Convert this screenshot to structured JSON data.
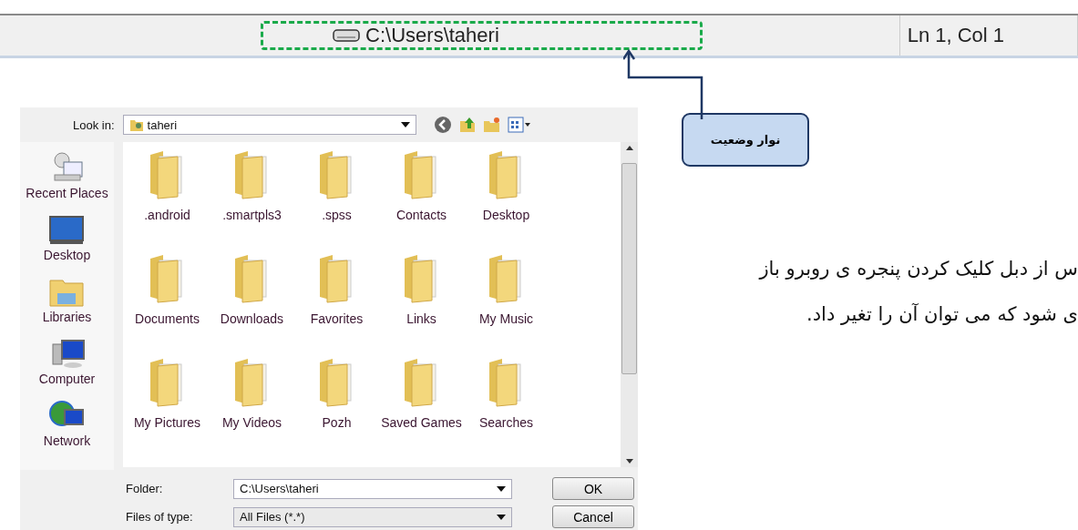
{
  "status_bar": {
    "path": "C:\\Users\\taheri",
    "position": "Ln 1, Col 1"
  },
  "callout": {
    "label": "نوار وضعیت"
  },
  "dialog": {
    "look_in": {
      "label": "Look in:",
      "value": "taheri"
    },
    "places": [
      {
        "label": "Recent Places",
        "kind": "recent"
      },
      {
        "label": "Desktop",
        "kind": "desktop"
      },
      {
        "label": "Libraries",
        "kind": "libraries"
      },
      {
        "label": "Computer",
        "kind": "computer"
      },
      {
        "label": "Network",
        "kind": "network"
      }
    ],
    "files": [
      ".android",
      ".smartpls3",
      ".spss",
      "Contacts",
      "Desktop",
      "Documents",
      "Downloads",
      "Favorites",
      "Links",
      "My Music",
      "My Pictures",
      "My Videos",
      "Pozh",
      "Saved Games",
      "Searches"
    ],
    "folder": {
      "label": "Folder:",
      "value": "C:\\Users\\taheri"
    },
    "file_type": {
      "label": "Files of type:",
      "value": "All Files (*.*)"
    },
    "buttons": [
      "OK",
      "Cancel"
    ]
  },
  "paragraph": [
    "س از دبل کلیک کردن پنجره ی روبرو باز",
    "ی شود که می توان آن را تغیر داد."
  ]
}
